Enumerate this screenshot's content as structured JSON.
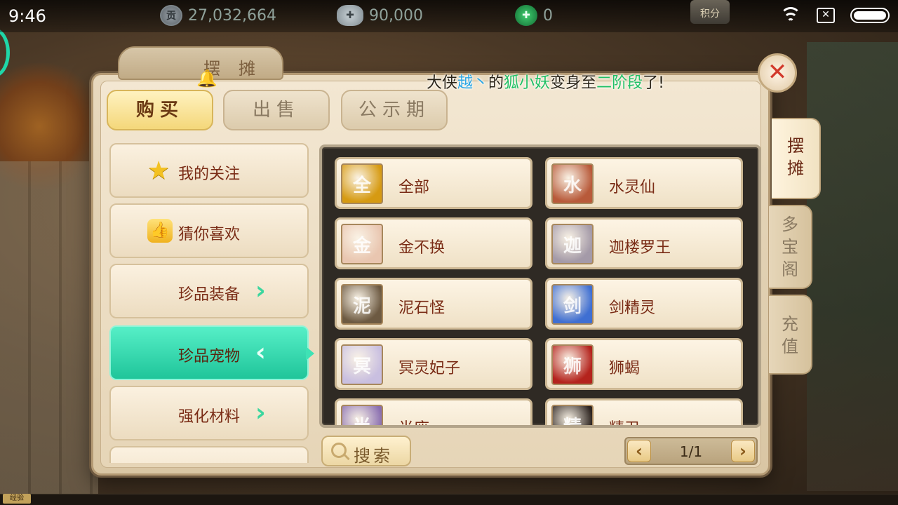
{
  "status_bar": {
    "time": "9:46",
    "coin_icon_glyph": "贡",
    "coin_value": "27,032,664",
    "silver_value": "90,000",
    "jade_value": "0",
    "score_label": "积分"
  },
  "window": {
    "title": "摆摊",
    "close_label": "✕",
    "announcement": {
      "p1": "大侠",
      "player": "越丶",
      "p2": "的",
      "pet": "狐小妖",
      "p3": "变身至",
      "stage": "二阶段",
      "p4": "了!"
    }
  },
  "top_tabs": [
    {
      "label": "购买",
      "active": true
    },
    {
      "label": "出售",
      "active": false
    },
    {
      "label": "公示期",
      "active": false
    }
  ],
  "left_menu": [
    {
      "label": "我的关注",
      "icon": "star-icon"
    },
    {
      "label": "猜你喜欢",
      "icon": "thumbs-up-icon"
    },
    {
      "label": "珍品装备",
      "icon": "chevron-right-icon"
    },
    {
      "label": "珍品宠物",
      "icon": "chevron-left-icon",
      "active": true
    },
    {
      "label": "强化材料",
      "icon": "chevron-right-icon"
    }
  ],
  "pets": [
    {
      "name": "全部",
      "color": "#d69a12",
      "glyph": "全"
    },
    {
      "name": "水灵仙",
      "color": "#b85a3a",
      "glyph": "水"
    },
    {
      "name": "金不换",
      "color": "#e9c6b0",
      "glyph": "金"
    },
    {
      "name": "迦楼罗王",
      "color": "#a49aa8",
      "glyph": "迦"
    },
    {
      "name": "泥石怪",
      "color": "#6d5a42",
      "glyph": "泥"
    },
    {
      "name": "剑精灵",
      "color": "#3f6fd2",
      "glyph": "剑"
    },
    {
      "name": "冥灵妃子",
      "color": "#c9bfe0",
      "glyph": "冥"
    },
    {
      "name": "狮蝎",
      "color": "#b4231d",
      "glyph": "狮"
    },
    {
      "name": "半座",
      "color": "#8a6fb0",
      "glyph": "半"
    },
    {
      "name": "精卫",
      "color": "#2d2420",
      "glyph": "精"
    }
  ],
  "search": {
    "label": "搜索"
  },
  "pager": {
    "prev": "‹",
    "next": "›",
    "page_text": "1/1"
  },
  "side_tabs": [
    {
      "label": [
        "摆",
        "摊"
      ],
      "active": true
    },
    {
      "label": [
        "多",
        "宝",
        "阁"
      ],
      "active": false
    },
    {
      "label": [
        "充",
        "值"
      ],
      "active": false
    }
  ],
  "exp_label": "经验",
  "colors": {
    "accent_teal": "#1fc59a",
    "title_red": "#7a2c16",
    "close_red": "#d23a2c",
    "announce_blue": "#2aa7e6",
    "announce_green": "#1fc064"
  }
}
